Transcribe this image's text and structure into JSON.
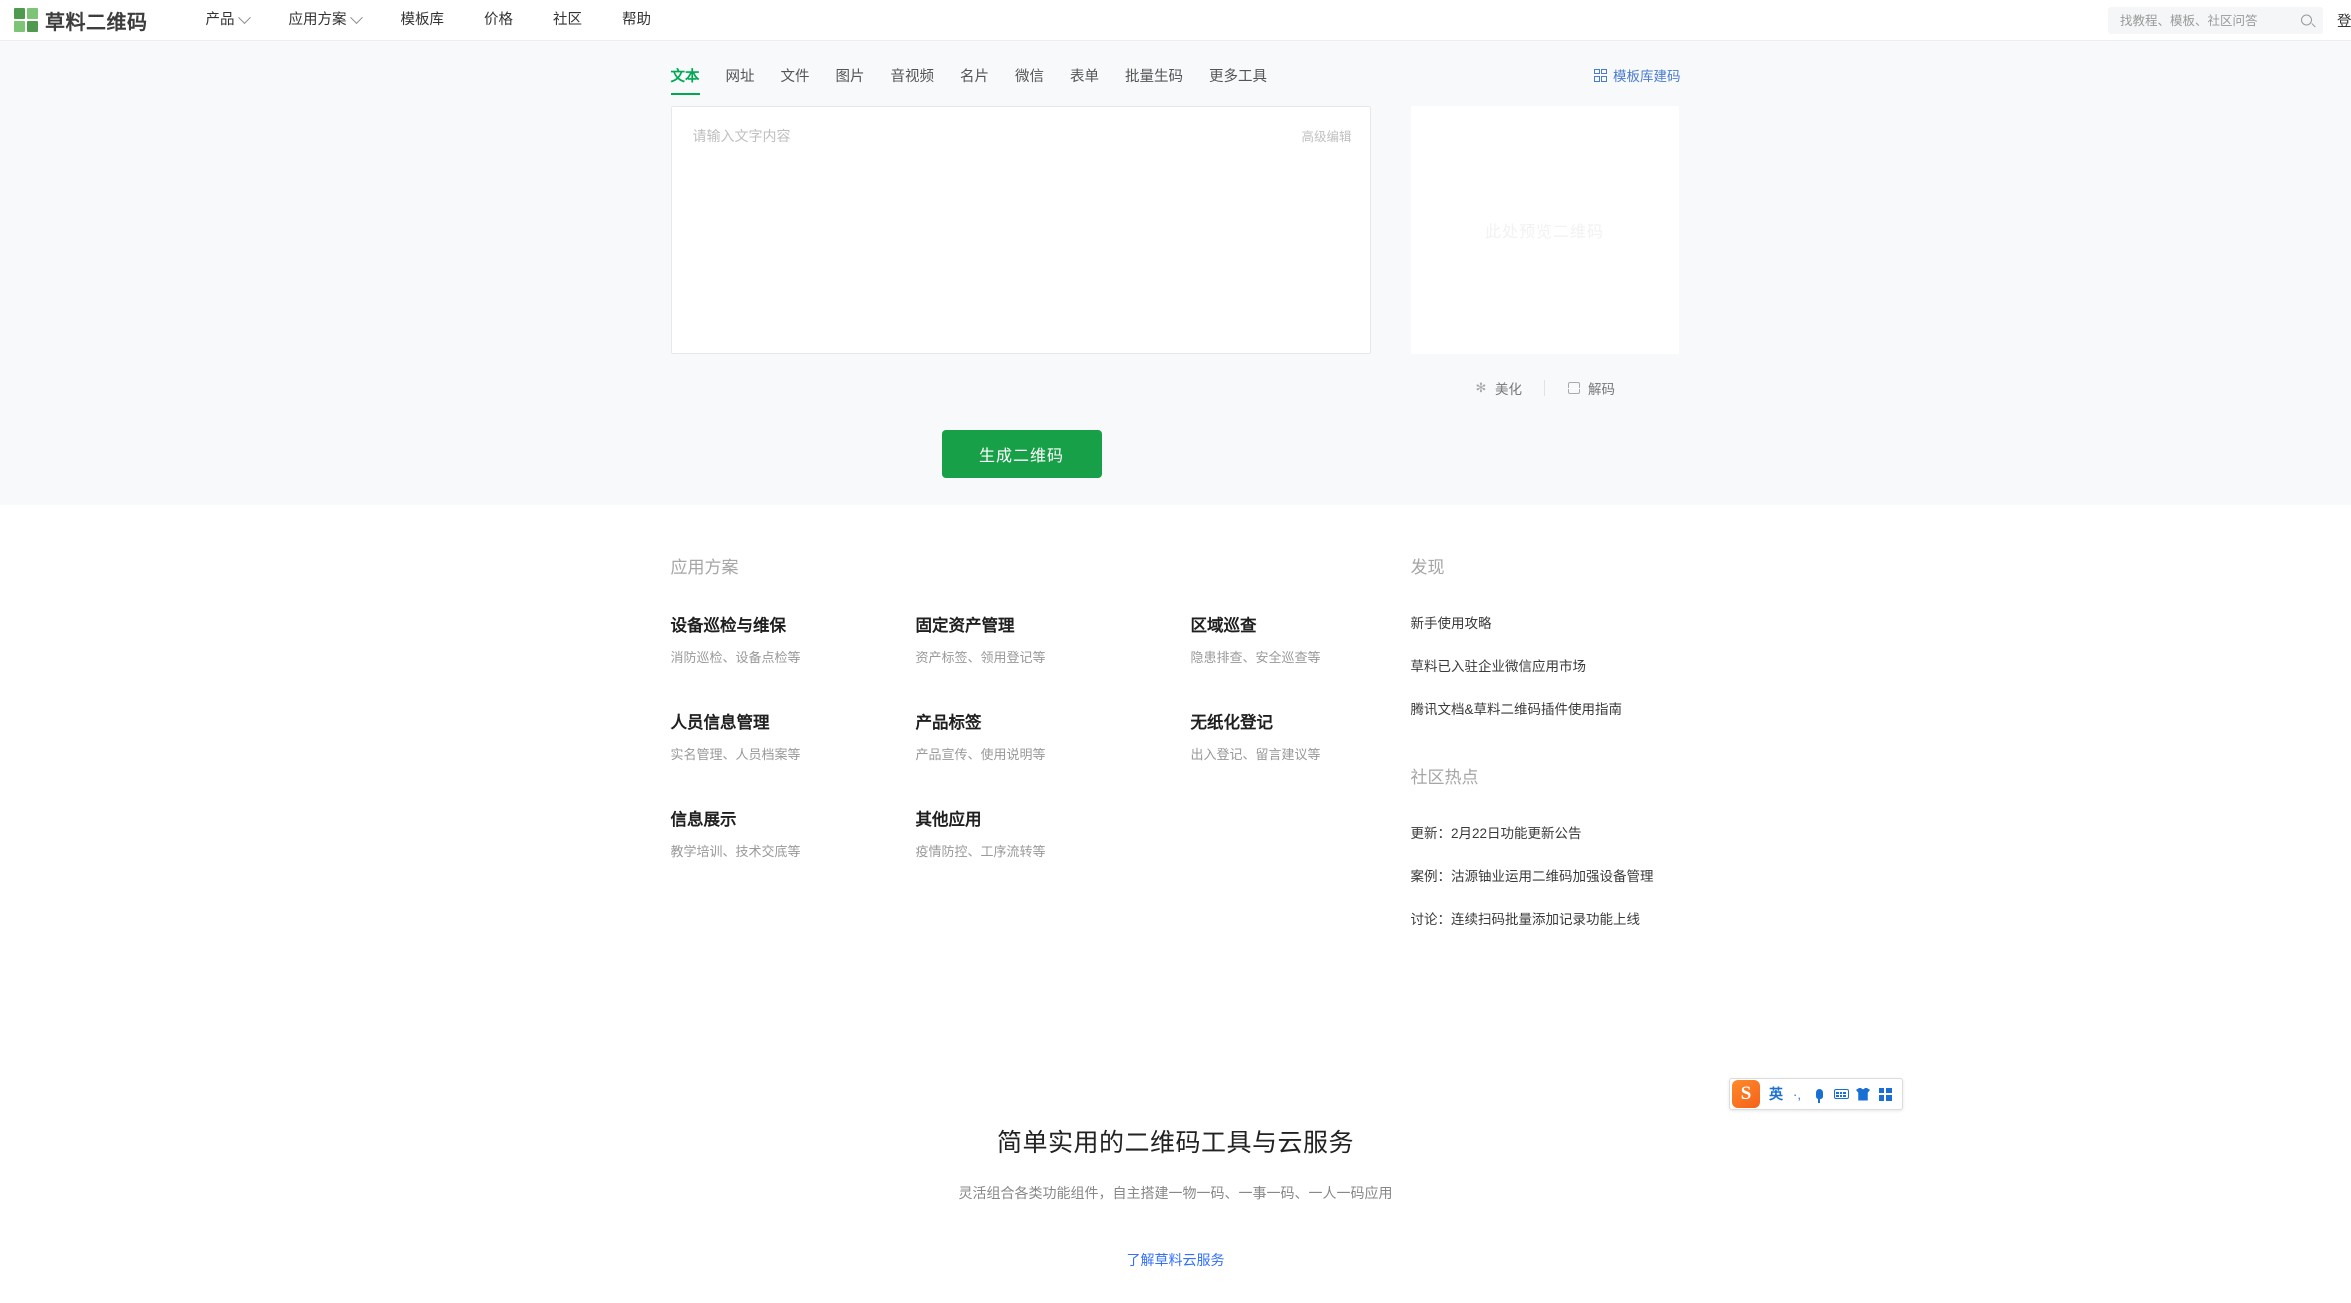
{
  "header": {
    "logo_text": "草料二维码",
    "nav": [
      {
        "label": "产品",
        "has_dropdown": true
      },
      {
        "label": "应用方案",
        "has_dropdown": true
      },
      {
        "label": "模板库",
        "has_dropdown": false
      },
      {
        "label": "价格",
        "has_dropdown": false
      },
      {
        "label": "社区",
        "has_dropdown": false
      },
      {
        "label": "帮助",
        "has_dropdown": false
      }
    ],
    "search": {
      "placeholder": "找教程、模板、社区问答",
      "value": ""
    },
    "login_label": "登录"
  },
  "tool": {
    "tabs": [
      {
        "label": "文本",
        "active": true
      },
      {
        "label": "网址",
        "active": false
      },
      {
        "label": "文件",
        "active": false
      },
      {
        "label": "图片",
        "active": false
      },
      {
        "label": "音视频",
        "active": false
      },
      {
        "label": "名片",
        "active": false
      },
      {
        "label": "微信",
        "active": false
      },
      {
        "label": "表单",
        "active": false
      },
      {
        "label": "批量生码",
        "active": false
      },
      {
        "label": "更多工具",
        "active": false
      }
    ],
    "template_link": "模板库建码",
    "editor": {
      "placeholder": "请输入文字内容",
      "value": "",
      "advanced_edit_label": "高级编辑"
    },
    "preview": {
      "placeholder_text": "此处预览二维码",
      "actions": [
        {
          "label": "美化",
          "icon": "sparkle-icon"
        },
        {
          "label": "解码",
          "icon": "scan-icon"
        }
      ]
    },
    "generate_button": "生成二维码"
  },
  "footer": {
    "solutions_title": "应用方案",
    "categories": [
      {
        "title": "设备巡检与维保",
        "sub": "消防巡检、设备点检等"
      },
      {
        "title": "固定资产管理",
        "sub": "资产标签、领用登记等"
      },
      {
        "title": "区域巡查",
        "sub": "隐患排查、安全巡查等"
      },
      {
        "title": "人员信息管理",
        "sub": "实名管理、人员档案等"
      },
      {
        "title": "产品标签",
        "sub": "产品宣传、使用说明等"
      },
      {
        "title": "无纸化登记",
        "sub": "出入登记、留言建议等"
      },
      {
        "title": "信息展示",
        "sub": "教学培训、技术交底等"
      },
      {
        "title": "其他应用",
        "sub": "疫情防控、工序流转等"
      }
    ],
    "discover_title": "发现",
    "discover_items": [
      "新手使用攻略",
      "草料已入驻企业微信应用市场",
      "腾讯文档&草料二维码插件使用指南"
    ],
    "community_title": "社区热点",
    "community_items": [
      "更新：2月22日功能更新公告",
      "案例：沽源铀业运用二维码加强设备管理",
      "讨论：连续扫码批量添加记录功能上线"
    ]
  },
  "promo": {
    "title": "简单实用的二维码工具与云服务",
    "subtitle": "灵活组合各类功能组件，自主搭建一物一码、一事一码、一人一码应用",
    "link": "了解草料云服务"
  },
  "ime": {
    "logo_letter": "S",
    "lang_label": "英",
    "punct_label": "·,",
    "buttons": [
      "sogou-logo",
      "lang-toggle",
      "punctuation-toggle",
      "voice-input-icon",
      "soft-keyboard-icon",
      "skin-icon",
      "toolbox-icon"
    ]
  },
  "colors": {
    "brand_green": "#18a048",
    "accent_blue": "#3370ff",
    "tool_bg": "#f8f9fa"
  }
}
